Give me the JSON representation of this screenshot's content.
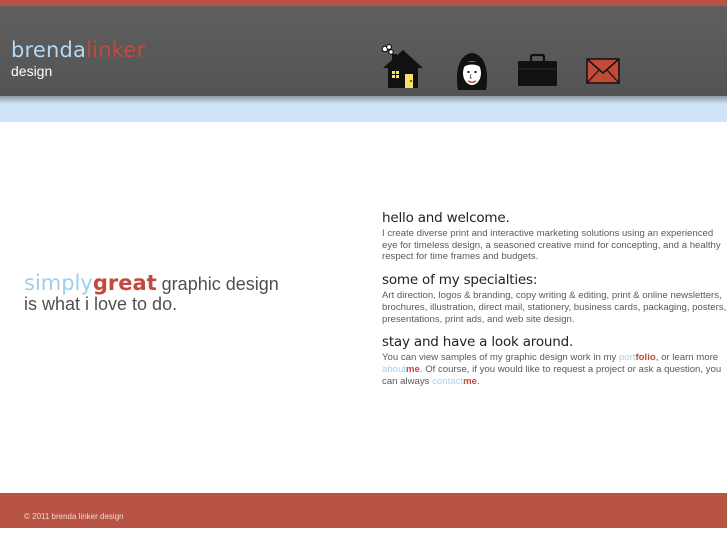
{
  "logo": {
    "first": "brenda",
    "last": "linker",
    "sub": "design"
  },
  "nav": [
    {
      "label": "home",
      "icon": "house-icon"
    },
    {
      "label": "about",
      "icon": "portrait-icon"
    },
    {
      "label": "portfolio",
      "icon": "briefcase-icon"
    },
    {
      "label": "contact",
      "icon": "envelope-icon"
    }
  ],
  "tagline": {
    "simply": "simply",
    "great": "great",
    "rest": " graphic design",
    "line2": "is what i love to do."
  },
  "sections": {
    "welcome": {
      "heading": "hello and welcome.",
      "body": "I create diverse print and interactive marketing solutions using an experienced eye for timeless design, a seasoned creative mind for concepting, and a healthy respect for time frames and budgets."
    },
    "specialties": {
      "heading": "some of my specialties:",
      "body": "Art direction, logos & branding, copy writing & editing, print & online newsletters, brochures, illustration, direct mail, stationery, business cards, packaging, posters, presentations, print ads, and web site design."
    },
    "lookaround": {
      "heading": "stay and have a look around.",
      "part1": "You can view samples of my graphic design work in my ",
      "link1a": "port",
      "link1b": "folio",
      "part2": ", or learn more ",
      "link2a": "about",
      "link2b": "me",
      "part3": ". Of course, if you would like to request a project or ask a question, you can always ",
      "link3a": "contact",
      "link3b": "me",
      "part4": "."
    }
  },
  "footer": {
    "copyright": "© 2011 brenda linker design"
  },
  "colors": {
    "accent_red": "#c14a3c",
    "accent_blue": "#a6d2f1",
    "header_gray": "#5a5a5a"
  }
}
